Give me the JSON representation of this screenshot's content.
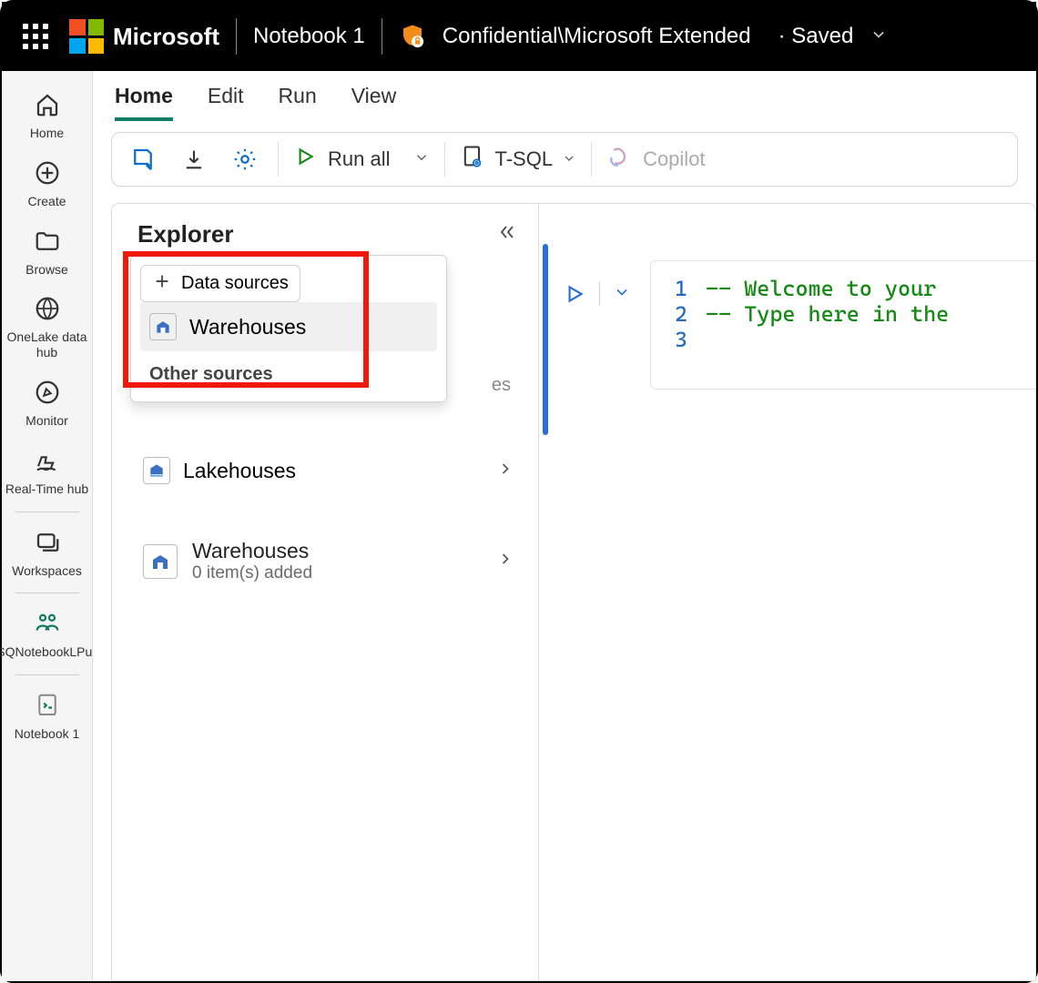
{
  "topbar": {
    "brand": "Microsoft",
    "notebook_name": "Notebook 1",
    "classification": "Confidential\\Microsoft Extended",
    "save_status": "· Saved"
  },
  "sidebar": {
    "items": [
      {
        "label": "Home"
      },
      {
        "label": "Create"
      },
      {
        "label": "Browse"
      },
      {
        "label": "OneLake data hub"
      },
      {
        "label": "Monitor"
      },
      {
        "label": "Real-Time hub"
      },
      {
        "label": "Workspaces"
      },
      {
        "label": "TSQNotebookLPuPr"
      },
      {
        "label": "Notebook 1"
      }
    ]
  },
  "tabs": {
    "items": [
      "Home",
      "Edit",
      "Run",
      "View"
    ],
    "active": "Home"
  },
  "toolbar": {
    "run_all": "Run all",
    "tsql": "T-SQL",
    "copilot": "Copilot"
  },
  "explorer": {
    "title": "Explorer",
    "data_sources_button": "Data sources",
    "popup_item_warehouses": "Warehouses",
    "other_sources_heading": "Other sources",
    "lakehouses": "Lakehouses",
    "partial_hidden": "es",
    "warehouses_section": {
      "title": "Warehouses",
      "subtitle": "0 item(s) added"
    }
  },
  "editor": {
    "lines": [
      {
        "n": "1",
        "text": "-- Welcome to your"
      },
      {
        "n": "2",
        "text": "-- Type here in the"
      },
      {
        "n": "3",
        "text": ""
      }
    ]
  }
}
